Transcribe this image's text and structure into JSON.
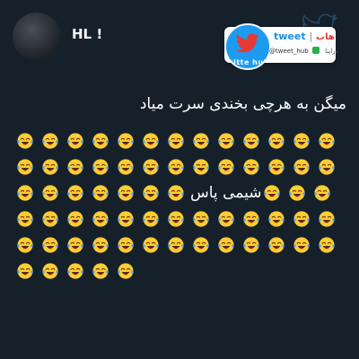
{
  "author": {
    "display_name": "HL !"
  },
  "watermark": {
    "brand_label": "tweet",
    "alt_label": "هاب",
    "handle": "@tweet_hub",
    "handle_alt": "دراپتا",
    "logo_text": "witte hub"
  },
  "tweet": {
    "line1": "میگن به هرچی بخندی سرت میاد",
    "inline_phrase": "شیمی پاس",
    "emoji_name": "face-with-tears-of-joy",
    "rows": [
      {
        "before": 13,
        "after": 0
      },
      {
        "before": 13,
        "after": 0
      },
      {
        "before": 7,
        "after": 3
      },
      {
        "before": 13,
        "after": 0
      },
      {
        "before": 13,
        "after": 0
      },
      {
        "before": 5,
        "after": 0
      }
    ]
  },
  "colors": {
    "background": "#15202b",
    "text": "#ffffff",
    "twitter_blue": "#1d9bf0"
  }
}
